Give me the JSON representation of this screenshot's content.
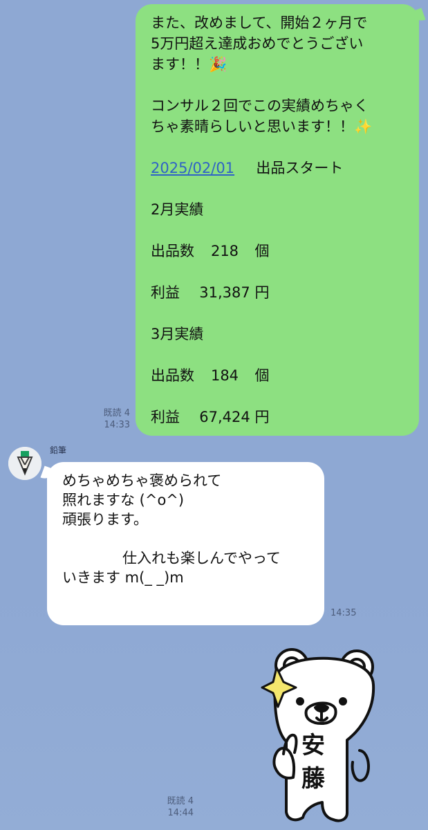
{
  "outgoing_message": {
    "lines": [
      "また、改めまして、開始２ヶ月で",
      "5万円超え達成おめでとうござい",
      "ます！！🎉",
      "",
      "コンサル２回でこの実績めちゃく",
      "ちゃ素晴らしいと思います！！✨"
    ],
    "date_link": "2025/02/01",
    "date_text": "出品スタート",
    "feb_title": "2月実績",
    "feb_items": [
      {
        "label": "出品数",
        "value": "218",
        "unit": "個"
      },
      {
        "label": "利益",
        "value": "31,387",
        "unit": "円"
      }
    ],
    "mar_title": "3月実績",
    "mar_items": [
      {
        "label": "出品数",
        "value": "184",
        "unit": "個"
      },
      {
        "label": "利益",
        "value": "67,424",
        "unit": "円"
      }
    ],
    "read_status": "既読 4",
    "time": "14:33"
  },
  "incoming_message": {
    "sender": "鉛筆",
    "lines": [
      "めちゃめちゃ褒められて",
      "照れますな (^o^)",
      "頑張ります。",
      "",
      "仕入れも楽しんでやって",
      "いきます m(_ _)m"
    ],
    "time": "14:35"
  },
  "sticker": {
    "text_lines": [
      "安",
      "藤"
    ]
  },
  "bottom_status": {
    "read_status": "既読 4",
    "time": "14:44"
  }
}
